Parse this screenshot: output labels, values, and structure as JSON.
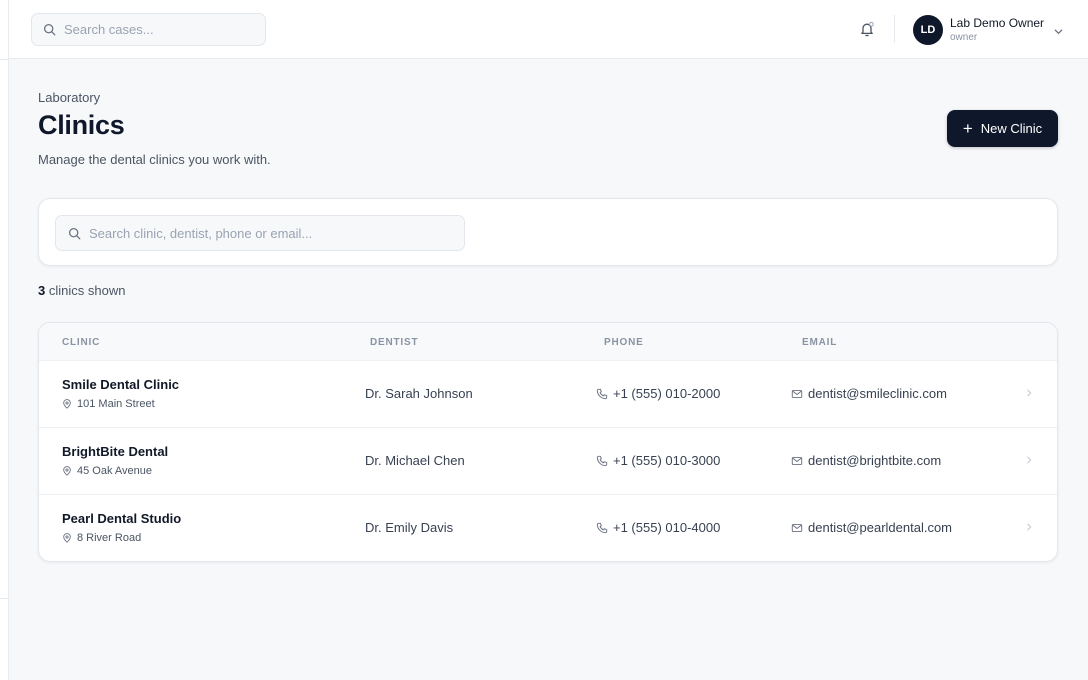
{
  "header": {
    "search_placeholder": "Search cases...",
    "user": {
      "initials": "LD",
      "name": "Lab Demo Owner",
      "role": "owner"
    }
  },
  "page": {
    "eyebrow": "Laboratory",
    "title": "Clinics",
    "subtitle": "Manage the dental clinics you work with.",
    "new_button_label": "New Clinic"
  },
  "filter": {
    "search_placeholder": "Search clinic, dentist, phone or email..."
  },
  "count": {
    "number": "3",
    "label": "clinics shown"
  },
  "table": {
    "columns": [
      "CLINIC",
      "DENTIST",
      "PHONE",
      "EMAIL"
    ],
    "rows": [
      {
        "clinic": "Smile Dental Clinic",
        "address": "101 Main Street",
        "dentist": "Dr. Sarah Johnson",
        "phone": "+1 (555) 010-2000",
        "email": "dentist@smileclinic.com"
      },
      {
        "clinic": "BrightBite Dental",
        "address": "45 Oak Avenue",
        "dentist": "Dr. Michael Chen",
        "phone": "+1 (555) 010-3000",
        "email": "dentist@brightbite.com"
      },
      {
        "clinic": "Pearl Dental Studio",
        "address": "8 River Road",
        "dentist": "Dr. Emily Davis",
        "phone": "+1 (555) 010-4000",
        "email": "dentist@pearldental.com"
      }
    ]
  },
  "icons": [
    "search-icon",
    "bell-icon",
    "chevron-down-icon",
    "plus-icon",
    "map-pin-icon",
    "phone-icon",
    "mail-icon",
    "chevron-right-icon"
  ],
  "colors": {
    "primary": "#0f172a",
    "background": "#f7f8fa",
    "muted_text": "#4b5563",
    "header_text": "#8a93a3"
  }
}
